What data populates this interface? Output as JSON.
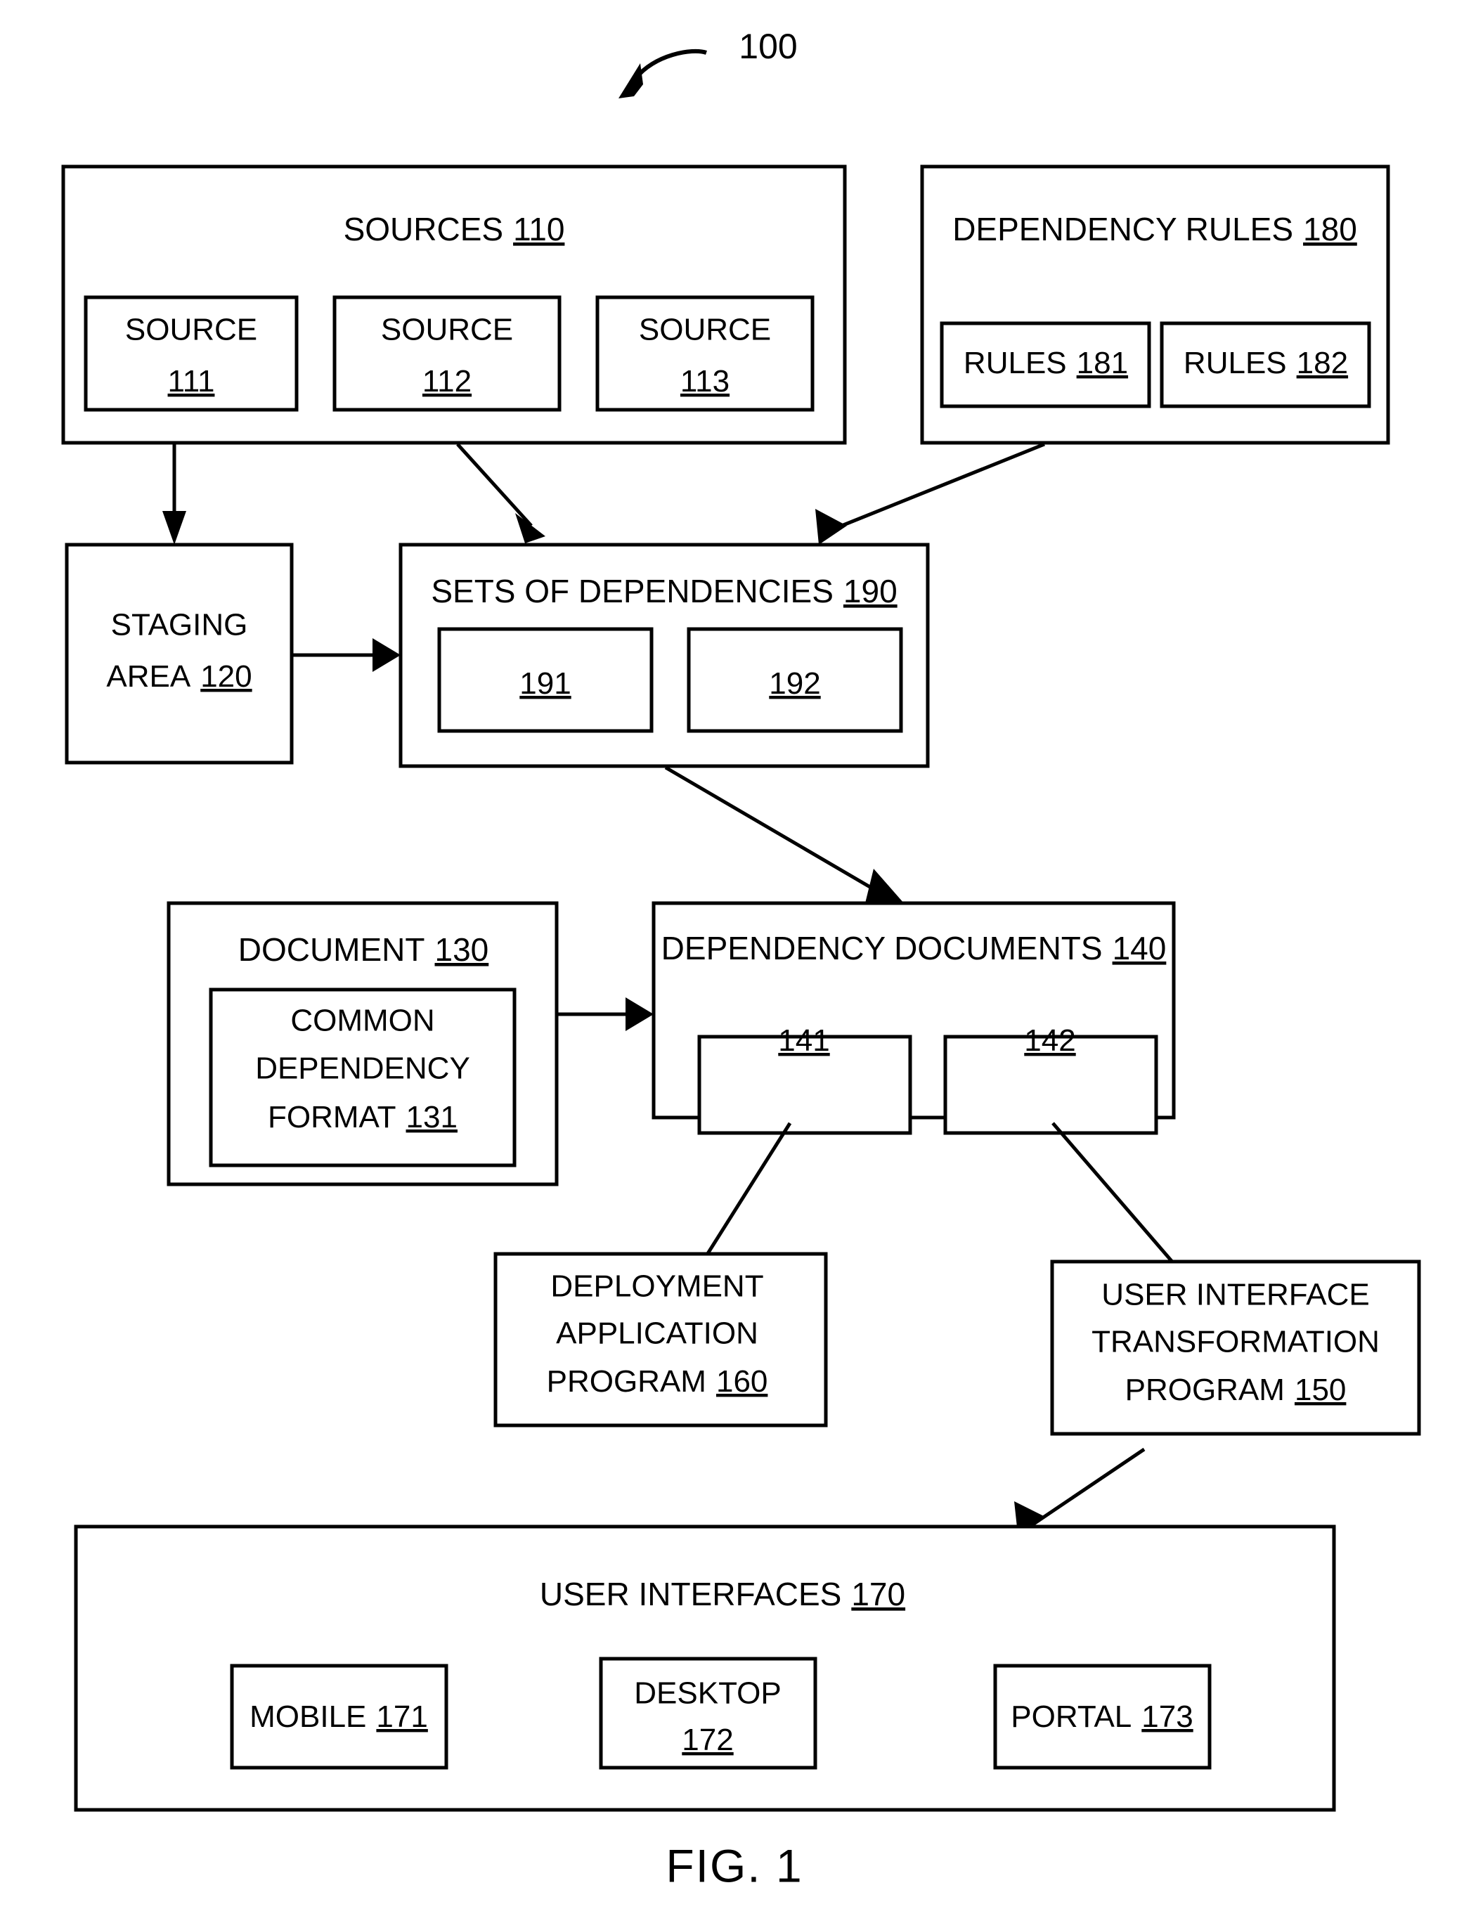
{
  "figure": {
    "caption": "FIG. 1",
    "system_label": "100"
  },
  "blocks": {
    "sources": {
      "title": "SOURCES",
      "ref": "110",
      "children": [
        {
          "label": "SOURCE",
          "ref": "111"
        },
        {
          "label": "SOURCE",
          "ref": "112"
        },
        {
          "label": "SOURCE",
          "ref": "113"
        }
      ]
    },
    "dependency_rules": {
      "title": "DEPENDENCY RULES",
      "ref": "180",
      "children": [
        {
          "label": "RULES",
          "ref": "181"
        },
        {
          "label": "RULES",
          "ref": "182"
        }
      ]
    },
    "staging_area": {
      "line1": "STAGING",
      "line2": "AREA",
      "ref": "120"
    },
    "sets_of_dependencies": {
      "title": "SETS OF DEPENDENCIES",
      "ref": "190",
      "children": [
        {
          "label": "",
          "ref": "191"
        },
        {
          "label": "",
          "ref": "192"
        }
      ]
    },
    "document": {
      "title": "DOCUMENT",
      "ref": "130",
      "inner": {
        "line1": "COMMON",
        "line2": "DEPENDENCY",
        "line3": "FORMAT",
        "ref": "131"
      }
    },
    "dependency_documents": {
      "title": "DEPENDENCY DOCUMENTS",
      "ref": "140",
      "children": [
        {
          "label": "",
          "ref": "141"
        },
        {
          "label": "",
          "ref": "142"
        }
      ]
    },
    "deployment_application_program": {
      "line1": "DEPLOYMENT",
      "line2": "APPLICATION",
      "line3": "PROGRAM",
      "ref": "160"
    },
    "user_interface_transformation_program": {
      "line1": "USER INTERFACE",
      "line2": "TRANSFORMATION",
      "line3": "PROGRAM",
      "ref": "150"
    },
    "user_interfaces": {
      "title": "USER INTERFACES",
      "ref": "170",
      "children": [
        {
          "label": "MOBILE",
          "ref": "171"
        },
        {
          "label": "DESKTOP",
          "ref": "172"
        },
        {
          "label": "PORTAL",
          "ref": "173"
        }
      ]
    }
  },
  "connections": [
    {
      "name": "sources-to-staging-area",
      "from": "sources",
      "to": "staging_area"
    },
    {
      "name": "sources-to-sets-of-dependencies",
      "from": "sources",
      "to": "sets_of_dependencies"
    },
    {
      "name": "dependency-rules-to-sets-of-dependencies",
      "from": "dependency_rules",
      "to": "sets_of_dependencies"
    },
    {
      "name": "staging-area-to-sets-of-dependencies",
      "from": "staging_area",
      "to": "sets_of_dependencies"
    },
    {
      "name": "sets-of-dependencies-to-dependency-documents",
      "from": "sets_of_dependencies",
      "to": "dependency_documents"
    },
    {
      "name": "document-to-dependency-documents",
      "from": "document",
      "to": "dependency_documents"
    },
    {
      "name": "dependency-documents-to-deployment-application-program",
      "from": "dependency_documents",
      "to": "deployment_application_program"
    },
    {
      "name": "dependency-documents-to-user-interface-transformation-program",
      "from": "dependency_documents",
      "to": "user_interface_transformation_program"
    },
    {
      "name": "user-interface-transformation-program-to-user-interfaces",
      "from": "user_interface_transformation_program",
      "to": "user_interfaces"
    }
  ],
  "colors": {
    "stroke": "#000000",
    "background": "#ffffff"
  }
}
